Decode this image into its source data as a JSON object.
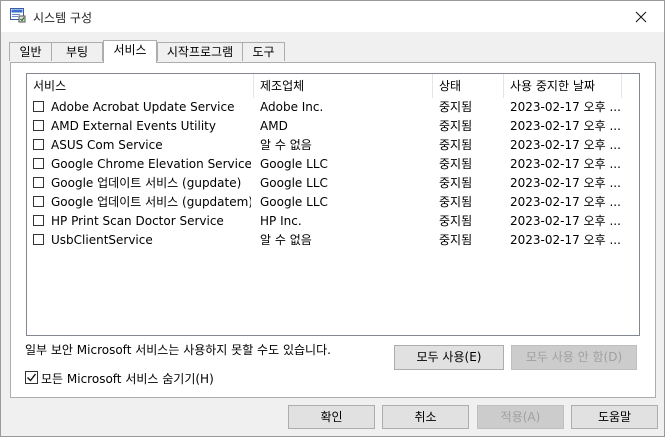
{
  "window": {
    "title": "시스템 구성",
    "close_icon": "close-icon",
    "app_icon": "msconfig-icon"
  },
  "tabs": [
    {
      "label": "일반",
      "active": false
    },
    {
      "label": "부팅",
      "active": false
    },
    {
      "label": "서비스",
      "active": true
    },
    {
      "label": "시작프로그램",
      "active": false
    },
    {
      "label": "도구",
      "active": false
    }
  ],
  "services": {
    "columns": [
      "서비스",
      "제조업체",
      "상태",
      "사용 중지한 날짜"
    ],
    "rows": [
      {
        "name": "Adobe Acrobat Update Service",
        "vendor": "Adobe Inc.",
        "status": "중지됨",
        "date": "2023-02-17 오후 ...",
        "checked": false
      },
      {
        "name": "AMD External Events Utility",
        "vendor": "AMD",
        "status": "중지됨",
        "date": "2023-02-17 오후 ...",
        "checked": false
      },
      {
        "name": "ASUS Com Service",
        "vendor": "알 수 없음",
        "status": "중지됨",
        "date": "2023-02-17 오후 ...",
        "checked": false
      },
      {
        "name": "Google Chrome Elevation Service (...",
        "vendor": "Google LLC",
        "status": "중지됨",
        "date": "2023-02-17 오후 ...",
        "checked": false
      },
      {
        "name": "Google 업데이트 서비스 (gupdate)",
        "vendor": "Google LLC",
        "status": "중지됨",
        "date": "2023-02-17 오후 ...",
        "checked": false
      },
      {
        "name": "Google 업데이트 서비스 (gupdatem)",
        "vendor": "Google LLC",
        "status": "중지됨",
        "date": "2023-02-17 오후 ...",
        "checked": false
      },
      {
        "name": "HP Print Scan Doctor Service",
        "vendor": "HP Inc.",
        "status": "중지됨",
        "date": "2023-02-17 오후 ...",
        "checked": false
      },
      {
        "name": "UsbClientService",
        "vendor": "알 수 없음",
        "status": "중지됨",
        "date": "2023-02-17 오후 ...",
        "checked": false
      }
    ]
  },
  "note": "일부 보안 Microsoft 서비스는 사용하지 못할 수도 있습니다.",
  "buttons": {
    "enable_all": "모두 사용(E)",
    "disable_all": "모두 사용 안 함(D)",
    "ok": "확인",
    "cancel": "취소",
    "apply": "적용(A)",
    "help": "도움말"
  },
  "hide_ms": {
    "label": "모든 Microsoft 서비스 숨기기(H)",
    "checked": true
  }
}
